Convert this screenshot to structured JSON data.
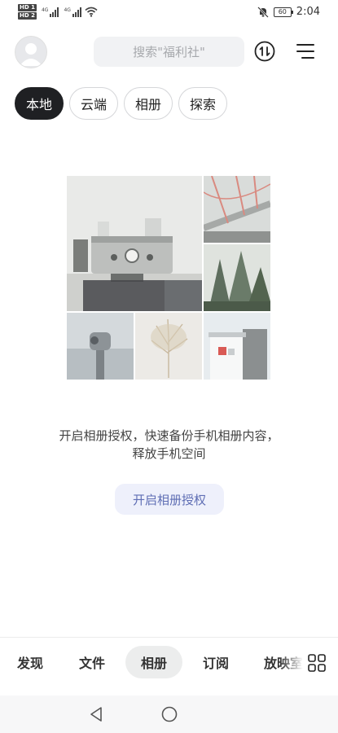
{
  "status_bar": {
    "sim1": "HD 1",
    "sim2": "HD 2",
    "network1": "4G",
    "network2": "4G",
    "battery": "60",
    "time": "2:04",
    "icons": [
      "signal-icon",
      "wifi-icon",
      "mute-bell-icon",
      "battery-icon"
    ]
  },
  "header": {
    "avatar_icon": "user-avatar-icon",
    "search_placeholder": "搜索\"福利社\"",
    "sort_icon": "sort-icon",
    "menu_icon": "menu-icon"
  },
  "tabs": [
    {
      "label": "本地",
      "active": true
    },
    {
      "label": "云端",
      "active": false
    },
    {
      "label": "相册",
      "active": false
    },
    {
      "label": "探索",
      "active": false
    }
  ],
  "empty_state": {
    "line1": "开启相册授权，快速备份手机相册内容，",
    "line2": "释放手机空间",
    "button_label": "开启相册授权"
  },
  "bottom_nav": {
    "items": [
      {
        "label": "发现",
        "active": false
      },
      {
        "label": "文件",
        "active": false
      },
      {
        "label": "相册",
        "active": true
      },
      {
        "label": "订阅",
        "active": false
      },
      {
        "label": "放映室",
        "active": false
      }
    ],
    "more_icon": "grid-icon"
  },
  "system_nav": {
    "icons": [
      "back-triangle-icon",
      "home-circle-icon"
    ]
  },
  "colors": {
    "active_tab_bg": "#1f2023",
    "button_bg": "#eef0fb",
    "button_text": "#5f6eb4",
    "search_bg": "#f1f2f4"
  }
}
